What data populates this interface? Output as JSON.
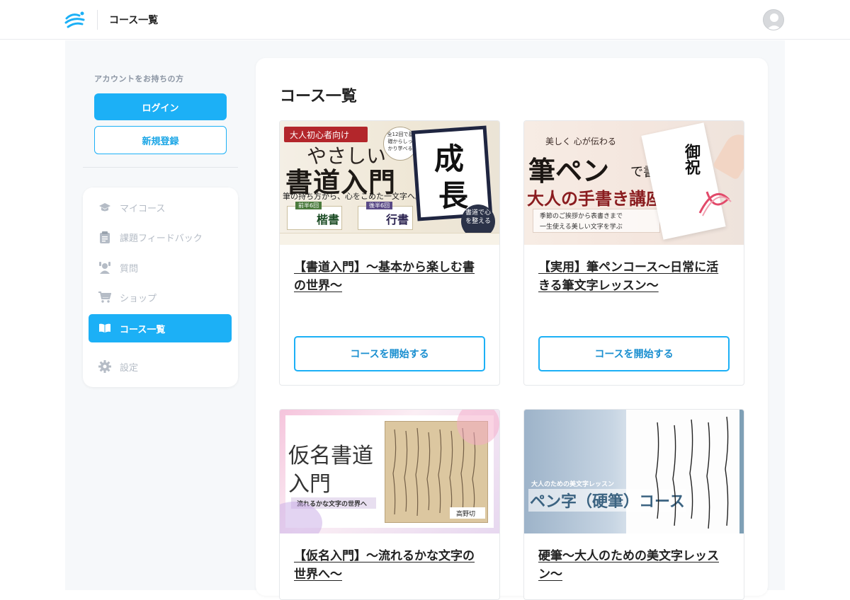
{
  "header": {
    "title": "コース一覧"
  },
  "sidebar": {
    "account_label": "アカウントをお持ちの方",
    "login_label": "ログイン",
    "register_label": "新規登録",
    "nav": [
      {
        "label": "マイコース",
        "icon": "graduation-cap-icon",
        "active": false
      },
      {
        "label": "課題フィードバック",
        "icon": "clipboard-icon",
        "active": false
      },
      {
        "label": "質問",
        "icon": "question-person-icon",
        "active": false
      },
      {
        "label": "ショップ",
        "icon": "cart-icon",
        "active": false
      },
      {
        "label": "コース一覧",
        "icon": "book-open-icon",
        "active": true
      },
      {
        "label": "設定",
        "icon": "gear-icon",
        "active": false
      }
    ]
  },
  "main": {
    "title": "コース一覧",
    "courses": [
      {
        "title": "【書道入門】～基本から楽しむ書の世界～",
        "button_label": "コースを開始する",
        "thumb": {
          "badge": "大人初心者向け",
          "line1": "やさしい",
          "line2": "書道入門",
          "sub": "筆の持ち方から、心をこめた一文字へ。",
          "circle": "全12回で基礎からしっかり学べる",
          "big1": "成",
          "big2": "長",
          "b1": "前半6回",
          "b1txt": "楷書",
          "b2": "後半6回",
          "b2txt": "行書",
          "stamp": "書道で心を整える"
        }
      },
      {
        "title": "【実用】筆ペンコース～日常に活きる筆文字レッスン～",
        "button_label": "コースを開始する",
        "thumb": {
          "top": "美しく 心が伝わる",
          "line1": "筆ペン",
          "line1b": "で書く",
          "line2": "大人の手書き講座",
          "sub1": "季節のご挨拶から表書きまで",
          "sub2": "一生使える美しい文字を学ぶ",
          "card": "御祝"
        }
      },
      {
        "title": "【仮名入門】～流れるかな文字の世界へ～",
        "thumb": {
          "line1": "仮名書道",
          "line2": "入門",
          "sub": "流れるかな文字の世界へ",
          "tag": "高野切"
        }
      },
      {
        "title": "硬筆～大人のための美文字レッスン～",
        "thumb": {
          "small": "大人のための美文字レッスン",
          "big": "ペン字（硬筆）コース"
        }
      }
    ]
  }
}
